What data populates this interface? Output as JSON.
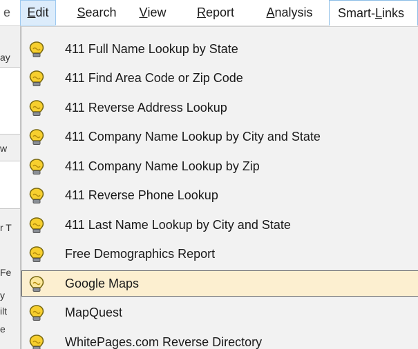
{
  "menubar": {
    "left_fragment": "e",
    "items": [
      {
        "before": "",
        "mnemonic": "E",
        "after": "dit"
      },
      {
        "before": "",
        "mnemonic": "S",
        "after": "earch"
      },
      {
        "before": "",
        "mnemonic": "V",
        "after": "iew"
      },
      {
        "before": "",
        "mnemonic": "R",
        "after": "eport"
      },
      {
        "before": "",
        "mnemonic": "A",
        "after": "nalysis"
      },
      {
        "before": "Smart-",
        "mnemonic": "L",
        "after": "inks"
      }
    ]
  },
  "background": {
    "fragments": [
      "ay",
      "w",
      "r T",
      "Fe",
      "y",
      "ilt",
      "e"
    ]
  },
  "menu": {
    "icon": "lightbulb-icon",
    "highlight_color": "#fcefd0",
    "items": [
      {
        "label": "411 Full Name Lookup by State"
      },
      {
        "label": "411 Find Area Code or Zip Code"
      },
      {
        "label": "411 Reverse Address Lookup"
      },
      {
        "label": "411 Company Name Lookup by City and State"
      },
      {
        "label": "411 Company Name Lookup by Zip"
      },
      {
        "label": "411 Reverse Phone Lookup"
      },
      {
        "label": "411 Last Name Lookup by City and State"
      },
      {
        "label": "Free Demographics Report"
      },
      {
        "label": "Google Maps",
        "highlighted": true
      },
      {
        "label": "MapQuest"
      },
      {
        "label": "WhitePages.com Reverse Directory"
      }
    ]
  }
}
